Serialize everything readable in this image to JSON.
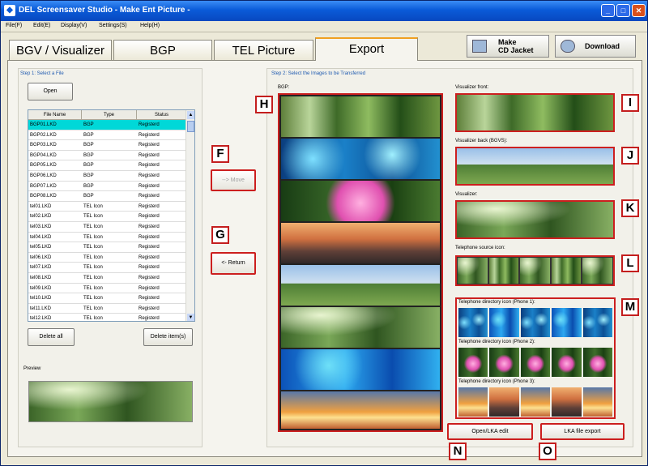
{
  "window": {
    "title": "DEL Screensaver Studio - Make Ent Picture -"
  },
  "menu": [
    "File(F)",
    "Edit(E)",
    "Display(V)",
    "Settings(S)",
    "Help(H)"
  ],
  "tabs": [
    "BGV / Visualizer",
    "BGP",
    "TEL Picture",
    "Export"
  ],
  "top_buttons": {
    "cd_jacket": "Make\nCD Jacket",
    "download": "Download"
  },
  "step1": {
    "label": "Step 1: Select a File",
    "open": "Open",
    "columns": [
      "File Name",
      "Type",
      "Status"
    ],
    "rows": [
      [
        "BGP01.LKD",
        "BGP",
        "Registerd"
      ],
      [
        "BGP02.LKD",
        "BGP",
        "Registerd"
      ],
      [
        "BGP03.LKD",
        "BGP",
        "Registerd"
      ],
      [
        "BGP04.LKD",
        "BGP",
        "Registerd"
      ],
      [
        "BGP05.LKD",
        "BGP",
        "Registerd"
      ],
      [
        "BGP06.LKD",
        "BGP",
        "Registerd"
      ],
      [
        "BGP07.LKD",
        "BGP",
        "Registerd"
      ],
      [
        "BGP08.LKD",
        "BGP",
        "Registerd"
      ],
      [
        "tel01.LKD",
        "TEL Icon",
        "Registerd"
      ],
      [
        "tel02.LKD",
        "TEL Icon",
        "Registerd"
      ],
      [
        "tel03.LKD",
        "TEL Icon",
        "Registerd"
      ],
      [
        "tel04.LKD",
        "TEL Icon",
        "Registerd"
      ],
      [
        "tel05.LKD",
        "TEL Icon",
        "Registerd"
      ],
      [
        "tel06.LKD",
        "TEL Icon",
        "Registerd"
      ],
      [
        "tel07.LKD",
        "TEL Icon",
        "Registerd"
      ],
      [
        "tel08.LKD",
        "TEL Icon",
        "Registerd"
      ],
      [
        "tel09.LKD",
        "TEL Icon",
        "Registerd"
      ],
      [
        "tel10.LKD",
        "TEL Icon",
        "Registerd"
      ],
      [
        "tel11.LKD",
        "TEL Icon",
        "Registerd"
      ],
      [
        "tel12.LKD",
        "TEL Icon",
        "Registerd"
      ]
    ],
    "delete_all": "Delete all",
    "delete_items": "Delete item(s)",
    "preview": "Preview"
  },
  "middle": {
    "move": "--> Move",
    "return": "<- Return"
  },
  "step2": {
    "label": "Step 2: Select the Images to be Transferred",
    "bgp": "BGP:",
    "vis_front": "Visualizer front:",
    "vis_back": "Visualizer back (BGVS):",
    "visualizer": "Visualizer:",
    "tel_source": "Telephone source icon:",
    "tel_dir1": "Telephone directory icon (Phone 1):",
    "tel_dir2": "Telephone directory icon (Phone 2):",
    "tel_dir3": "Telephone directory icon (Phone 3):",
    "open_edit": "Open/LKA edit",
    "export": "LKA file export"
  },
  "tags": {
    "F": "F",
    "G": "G",
    "H": "H",
    "I": "I",
    "J": "J",
    "K": "K",
    "L": "L",
    "M": "M",
    "N": "N",
    "O": "O"
  }
}
